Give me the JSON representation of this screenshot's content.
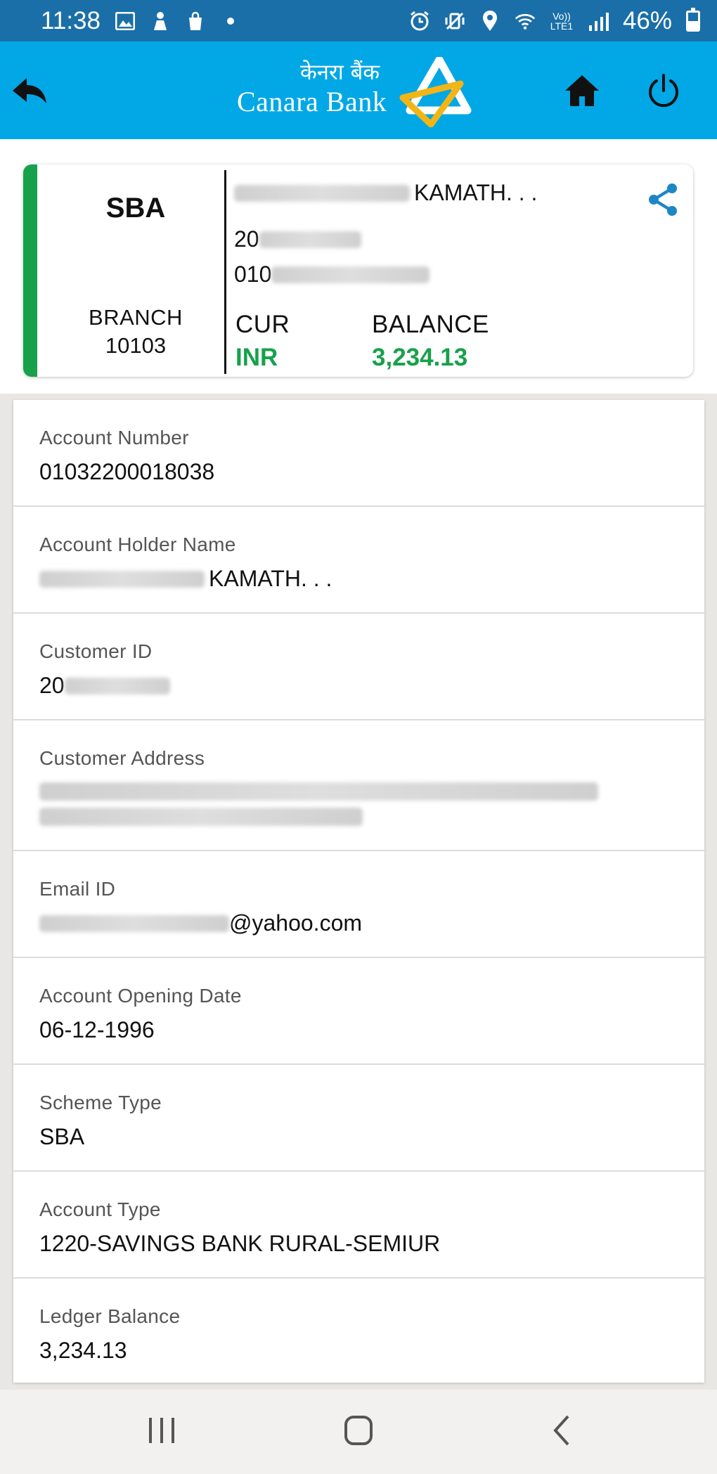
{
  "status_bar": {
    "time": "11:38",
    "battery_percent": "46%",
    "network_label": "Vo)) LTE1",
    "icons": [
      "image-icon",
      "assistant-icon",
      "bag-icon",
      "dot-icon",
      "alarm-icon",
      "mute-vibrate-icon",
      "location-icon",
      "wifi-icon",
      "signal-icon",
      "battery-icon"
    ]
  },
  "header": {
    "brand_hindi": "केनरा बैंक",
    "brand_name": "Canara Bank",
    "bg_color": "#02a7e6",
    "logo_colors": {
      "triangle": "#ffffff",
      "inner": "#f2b516"
    }
  },
  "summary": {
    "scheme": "SBA",
    "branch_label": "BRANCH",
    "branch_code": "10103",
    "holder_name_visible": "KAMATH. . .",
    "customer_id_prefix": "20",
    "account_prefix": "010",
    "cur_label": "CUR",
    "cur_value": "INR",
    "balance_label": "BALANCE",
    "balance_value": "3,234.13",
    "accent_color": "#17a14b"
  },
  "details": {
    "account_number": {
      "label": "Account Number",
      "value": "01032200018038"
    },
    "holder_name": {
      "label": "Account Holder Name",
      "value_suffix": "KAMATH. . ."
    },
    "customer_id": {
      "label": "Customer ID",
      "value_prefix": "20"
    },
    "customer_address": {
      "label": "Customer Address"
    },
    "email": {
      "label": "Email ID",
      "value_suffix": "@yahoo.com"
    },
    "opening_date": {
      "label": "Account Opening Date",
      "value": "06-12-1996"
    },
    "scheme_type": {
      "label": "Scheme Type",
      "value": "SBA"
    },
    "account_type": {
      "label": "Account Type",
      "value": "1220-SAVINGS BANK RURAL-SEMIUR"
    },
    "ledger_balance": {
      "label": "Ledger Balance",
      "value": "3,234.13"
    }
  }
}
